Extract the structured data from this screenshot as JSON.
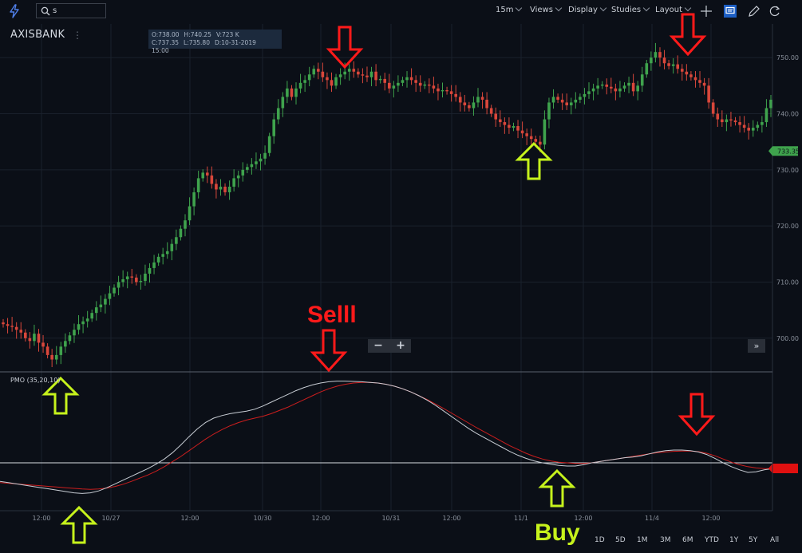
{
  "toolbar": {
    "search_value": "s",
    "interval": "15m",
    "views": "Views",
    "display": "Display",
    "studies": "Studies",
    "layout": "Layout"
  },
  "symbol": "AXISBANK",
  "ohlc": {
    "open": "O:738.00",
    "high": "H:740.25",
    "volume": "V:723 K",
    "close": "C:737.35",
    "low": "L:735.80",
    "date": "D:10-31-2019 15:00"
  },
  "indicator_label": "PMO (35,20,10)",
  "ranges": [
    "1D",
    "5D",
    "1M",
    "3M",
    "6M",
    "YTD",
    "1Y",
    "5Y",
    "All"
  ],
  "annotations": {
    "sell_text": "Selll",
    "buy_text": "Buy"
  },
  "colors": {
    "background": "#0b0f17",
    "up_candle": "#3fa34d",
    "down_candle": "#d9473b",
    "pmo_line": "#c8cdd4",
    "signal_line": "#cc1e1e",
    "sell_arrow": "#ff1a1a",
    "buy_arrow": "#c6f21c",
    "price_badge": "#3fa34d"
  },
  "chart_data": [
    {
      "type": "candlestick",
      "price_axis_ticks": [
        "750.00",
        "740.00",
        "730.00",
        "720.00",
        "710.00",
        "700.00"
      ],
      "ylim": [
        694,
        756
      ],
      "last_price": "733.35",
      "time_axis_ticks": [
        "12:00",
        "10/27",
        "12:00",
        "10/30",
        "12:00",
        "10/31",
        "12:00",
        "11/1",
        "12:00",
        "11/4",
        "12:00"
      ],
      "closes": [
        702.5,
        702.2,
        702.0,
        701.5,
        701.0,
        700.0,
        699.5,
        700.8,
        699.2,
        698.5,
        697.0,
        696.2,
        697.0,
        698.5,
        699.5,
        700.5,
        701.5,
        702.5,
        703.0,
        703.5,
        704.5,
        705.5,
        706.0,
        707.0,
        708.0,
        709.0,
        710.0,
        710.5,
        711.0,
        710.8,
        710.0,
        710.2,
        711.5,
        712.5,
        713.5,
        714.5,
        715.0,
        715.5,
        716.8,
        718.0,
        719.5,
        721.0,
        723.5,
        726.0,
        728.5,
        729.5,
        729.0,
        727.5,
        726.5,
        727.0,
        726.0,
        727.0,
        728.5,
        729.0,
        730.0,
        730.5,
        731.0,
        731.5,
        732.0,
        733.0,
        736.0,
        739.0,
        741.0,
        743.0,
        744.5,
        743.0,
        744.5,
        745.5,
        746.0,
        747.0,
        748.0,
        747.5,
        746.5,
        746.0,
        745.0,
        746.5,
        747.0,
        747.5,
        748.0,
        747.5,
        747.0,
        746.8,
        746.5,
        747.5,
        746.0,
        746.2,
        745.5,
        744.5,
        745.0,
        745.5,
        746.0,
        746.5,
        746.0,
        745.5,
        745.0,
        745.2,
        745.0,
        744.5,
        744.0,
        744.2,
        744.0,
        743.5,
        743.0,
        742.0,
        741.5,
        741.0,
        742.0,
        743.0,
        742.5,
        741.0,
        740.0,
        739.0,
        738.5,
        738.0,
        737.5,
        737.8,
        737.0,
        736.5,
        736.0,
        735.5,
        735.0,
        734.5,
        739.0,
        742.0,
        743.0,
        742.5,
        742.0,
        741.5,
        742.0,
        742.5,
        743.0,
        743.5,
        744.0,
        744.5,
        745.0,
        745.2,
        744.8,
        744.5,
        744.0,
        744.5,
        745.0,
        745.5,
        744.0,
        745.0,
        747.0,
        749.0,
        750.0,
        751.0,
        750.0,
        749.0,
        748.5,
        748.8,
        748.0,
        747.5,
        747.0,
        746.5,
        746.0,
        745.5,
        745.0,
        742.0,
        740.0,
        739.0,
        738.5,
        739.0,
        738.8,
        738.5,
        738.0,
        737.5,
        737.0,
        737.5,
        738.0,
        738.5,
        741.0,
        742.5
      ]
    },
    {
      "type": "line",
      "title": "PMO (35,20,10)",
      "series": [
        {
          "values": [
            -0.58,
            -0.62,
            -0.66,
            -0.7,
            -0.74,
            -0.78,
            -0.82,
            -0.86,
            -0.9,
            -0.94,
            -0.96,
            -0.94,
            -0.88,
            -0.78,
            -0.66,
            -0.54,
            -0.42,
            -0.3,
            -0.18,
            -0.04,
            0.12,
            0.32,
            0.56,
            0.82,
            1.06,
            1.26,
            1.4,
            1.48,
            1.54,
            1.58,
            1.62,
            1.68,
            1.78,
            1.9,
            2.02,
            2.14,
            2.26,
            2.36,
            2.44,
            2.5,
            2.54,
            2.56,
            2.56,
            2.55,
            2.54,
            2.52,
            2.5,
            2.46,
            2.4,
            2.32,
            2.22,
            2.1,
            1.96,
            1.8,
            1.62,
            1.44,
            1.26,
            1.08,
            0.92,
            0.78,
            0.64,
            0.5,
            0.36,
            0.24,
            0.14,
            0.06,
            0.0,
            -0.04,
            -0.08,
            -0.1,
            -0.1,
            -0.06,
            0.0,
            0.04,
            0.08,
            0.12,
            0.16,
            0.18,
            0.22,
            0.28,
            0.34,
            0.38,
            0.4,
            0.4,
            0.38,
            0.34,
            0.26,
            0.14,
            0.0,
            -0.12,
            -0.22,
            -0.3,
            -0.28,
            -0.22,
            -0.18
          ]
        },
        {
          "values": [
            -0.62,
            -0.64,
            -0.66,
            -0.68,
            -0.7,
            -0.72,
            -0.74,
            -0.76,
            -0.78,
            -0.8,
            -0.82,
            -0.83,
            -0.82,
            -0.79,
            -0.74,
            -0.67,
            -0.58,
            -0.48,
            -0.38,
            -0.26,
            -0.12,
            0.04,
            0.2,
            0.38,
            0.56,
            0.74,
            0.9,
            1.04,
            1.16,
            1.26,
            1.34,
            1.4,
            1.46,
            1.54,
            1.64,
            1.74,
            1.86,
            1.98,
            2.1,
            2.22,
            2.32,
            2.4,
            2.46,
            2.5,
            2.52,
            2.52,
            2.5,
            2.46,
            2.4,
            2.32,
            2.22,
            2.1,
            1.98,
            1.84,
            1.7,
            1.55,
            1.4,
            1.25,
            1.1,
            0.96,
            0.82,
            0.68,
            0.54,
            0.42,
            0.3,
            0.2,
            0.12,
            0.06,
            0.02,
            0.0,
            -0.02,
            -0.02,
            0.0,
            0.04,
            0.08,
            0.12,
            0.16,
            0.2,
            0.24,
            0.28,
            0.32,
            0.34,
            0.36,
            0.37,
            0.37,
            0.35,
            0.3,
            0.22,
            0.12,
            0.02,
            -0.06,
            -0.12,
            -0.16,
            -0.18,
            -0.18
          ]
        }
      ]
    }
  ]
}
